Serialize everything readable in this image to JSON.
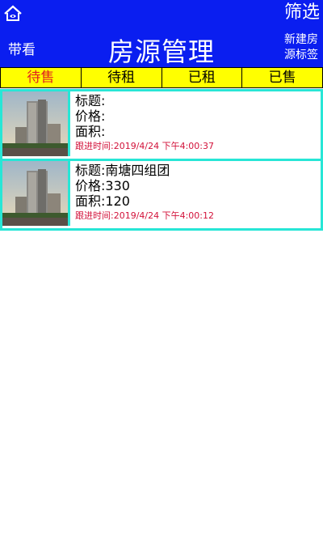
{
  "header": {
    "logo_icon": "house-logo-icon",
    "filter_label": "筛选",
    "daikan_label": "带看",
    "title": "房源管理",
    "new_tag_line1": "新建房",
    "new_tag_line2": "源标签",
    "background": "#0a1ef0"
  },
  "tabs": [
    {
      "label": "待售",
      "active": true
    },
    {
      "label": "待租",
      "active": false
    },
    {
      "label": "已租",
      "active": false
    },
    {
      "label": "已售",
      "active": false
    }
  ],
  "listings": [
    {
      "title_line": "标题:",
      "price_line": "价格:",
      "area_line": "面积:",
      "follow_line": "跟进时间:2019/4/24 下午4:00:37"
    },
    {
      "title_line": "标题:南塘四组团",
      "price_line": "价格:330",
      "area_line": "面积:120",
      "follow_line": "跟进时间:2019/4/24 下午4:00:12"
    }
  ],
  "colors": {
    "tab_bar": "#ffff00",
    "active_tab_text": "#e02020",
    "card_border": "#27e6d6",
    "follow_text": "#d2123a"
  }
}
